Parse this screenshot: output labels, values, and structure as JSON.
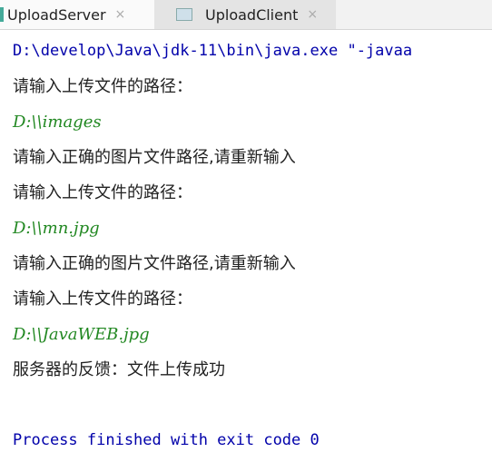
{
  "tabs": [
    {
      "label": "UploadServer",
      "close": "×"
    },
    {
      "label": "UploadClient",
      "close": "×"
    }
  ],
  "console": [
    {
      "text": "D:\\develop\\Java\\jdk-11\\bin\\java.exe \"-javaa",
      "kind": "mono"
    },
    {
      "text": "请输入上传文件的路径：",
      "kind": "cn"
    },
    {
      "text": "D:\\\\images",
      "kind": "in"
    },
    {
      "text": "请输入正确的图片文件路径,请重新输入",
      "kind": "cn"
    },
    {
      "text": "请输入上传文件的路径：",
      "kind": "cn"
    },
    {
      "text": "D:\\\\mn.jpg",
      "kind": "in"
    },
    {
      "text": "请输入正确的图片文件路径,请重新输入",
      "kind": "cn"
    },
    {
      "text": "请输入上传文件的路径：",
      "kind": "cn"
    },
    {
      "text": "D:\\\\JavaWEB.jpg",
      "kind": "in"
    },
    {
      "text": "服务器的反馈：文件上传成功",
      "kind": "cn"
    },
    {
      "text": "",
      "kind": "cn"
    },
    {
      "text": "Process finished with exit code 0",
      "kind": "mono"
    }
  ]
}
